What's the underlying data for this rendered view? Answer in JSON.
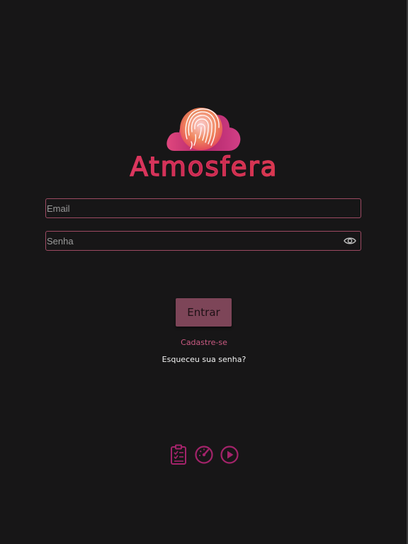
{
  "brand": {
    "name": "Atmosfera",
    "accent": "#d9355a",
    "logo_icon": "fingerprint-cloud-icon"
  },
  "login": {
    "email_placeholder": "Email",
    "email_value": "",
    "password_placeholder": "Senha",
    "password_value": "",
    "password_toggle_icon": "eye-icon",
    "submit_label": "Entrar",
    "signup_link": "Cadastre-se",
    "forgot_link": "Esqueceu sua senha?"
  },
  "bottom_icons": [
    {
      "icon": "clipboard-checklist-icon"
    },
    {
      "icon": "speedometer-icon"
    },
    {
      "icon": "play-circle-icon"
    }
  ],
  "colors": {
    "background": "#171617",
    "field_border": "#9c4a62",
    "button_bg": "#7d4558",
    "link_pink": "#c95a82",
    "icon_magenta": "#a3236a"
  }
}
